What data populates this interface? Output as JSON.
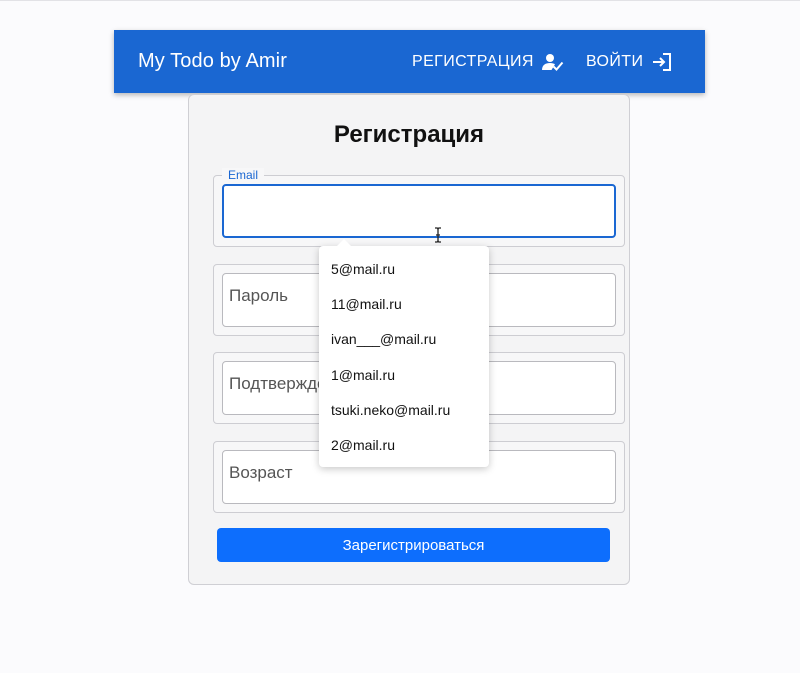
{
  "appbar": {
    "title": "My Todo by Amir",
    "register_label": "РЕГИСТРАЦИЯ",
    "login_label": "ВОЙТИ",
    "bg_color": "#1a67d2"
  },
  "form": {
    "title": "Регистрация",
    "email": {
      "label": "Email",
      "value": ""
    },
    "password": {
      "placeholder": "Пароль"
    },
    "confirm": {
      "placeholder": "Подтверждение пароля"
    },
    "age": {
      "placeholder": "Возраст"
    },
    "submit_label": "Зарегистрироваться",
    "submit_color": "#0d6efd"
  },
  "autocomplete": {
    "items": [
      "5@mail.ru",
      "11@mail.ru",
      "ivan___@mail.ru",
      "1@mail.ru",
      "tsuki.neko@mail.ru",
      "2@mail.ru"
    ]
  },
  "icons": {
    "register": "person-check-icon",
    "login": "login-icon",
    "cursor": "text-cursor-icon"
  }
}
